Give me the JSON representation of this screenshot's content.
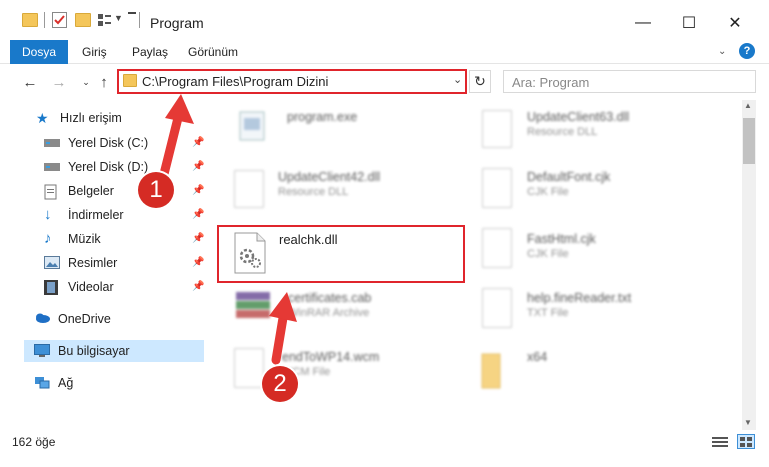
{
  "window": {
    "title": "Program",
    "minimize_glyph": "—",
    "maximize_glyph": "☐",
    "close_glyph": "✕"
  },
  "ribbon": {
    "tabs": [
      "Dosya",
      "Giriş",
      "Paylaş",
      "Görünüm"
    ],
    "help_glyph": "?"
  },
  "nav": {
    "address": "C:\\Program Files\\Program Dizini",
    "search_placeholder": "Ara: Program"
  },
  "sidebar": {
    "items": [
      {
        "label": "Hızlı erişim",
        "icon": "star-icon"
      },
      {
        "label": "Yerel Disk (C:)",
        "icon": "drive-icon"
      },
      {
        "label": "Yerel Disk (D:)",
        "icon": "drive-icon"
      },
      {
        "label": "Belgeler",
        "icon": "documents-icon"
      },
      {
        "label": "İndirmeler",
        "icon": "download-icon"
      },
      {
        "label": "Müzik",
        "icon": "music-icon"
      },
      {
        "label": "Resimler",
        "icon": "pictures-icon"
      },
      {
        "label": "Videolar",
        "icon": "video-icon"
      },
      {
        "label": "OneDrive",
        "icon": "cloud-icon"
      },
      {
        "label": "Bu bilgisayar",
        "icon": "computer-icon"
      },
      {
        "label": "Ağ",
        "icon": "network-icon"
      }
    ]
  },
  "files": [
    {
      "name": "program.exe",
      "type": ""
    },
    {
      "name": "UpdateClient63.dll",
      "type": "Resource DLL"
    },
    {
      "name": "UpdateClient42.dll",
      "type": "Resource DLL"
    },
    {
      "name": "DefaultFont.cjk",
      "type": "CJK File"
    },
    {
      "name": "realchk.dll",
      "type": ""
    },
    {
      "name": "FastHtml.cjk",
      "type": "CJK File"
    },
    {
      "name": "certificates.cab",
      "type": "WinRAR Archive"
    },
    {
      "name": "help.fineReader.txt",
      "type": "TXT File"
    },
    {
      "name": "endToWP14.wcm",
      "type": "WCM File"
    },
    {
      "name": "x64",
      "type": ""
    }
  ],
  "status": {
    "count": "162 öğe"
  },
  "markers": [
    "1",
    "2"
  ],
  "colors": {
    "accent": "#1979ca",
    "highlight": "#e0252c",
    "marker": "#d52b24",
    "selected": "#cde8ff"
  }
}
